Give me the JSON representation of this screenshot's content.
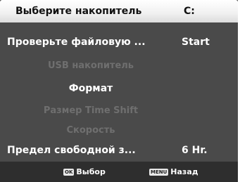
{
  "menu": {
    "items": [
      {
        "label": "Выберите накопитель",
        "value": "C:"
      },
      {
        "label": "Проверьте файловую ...",
        "value": "Start"
      },
      {
        "label": "USB накопитель",
        "value": ""
      },
      {
        "label": "Формат",
        "value": ""
      },
      {
        "label": "Размер Time Shift",
        "value": ""
      },
      {
        "label": "Скорость",
        "value": ""
      },
      {
        "label": "Предел свободной з...",
        "value": "6 Hr."
      }
    ]
  },
  "footer": {
    "ok_key": "OK",
    "ok_label": "Выбор",
    "menu_key": "MENU",
    "menu_label": "Назад"
  },
  "colors": {
    "background": "#4a4a4a",
    "highlight": "#ffffff",
    "text": "#ffffff",
    "disabled_text": "#6f6f6f",
    "footer_bg": "#2e2e2e"
  }
}
